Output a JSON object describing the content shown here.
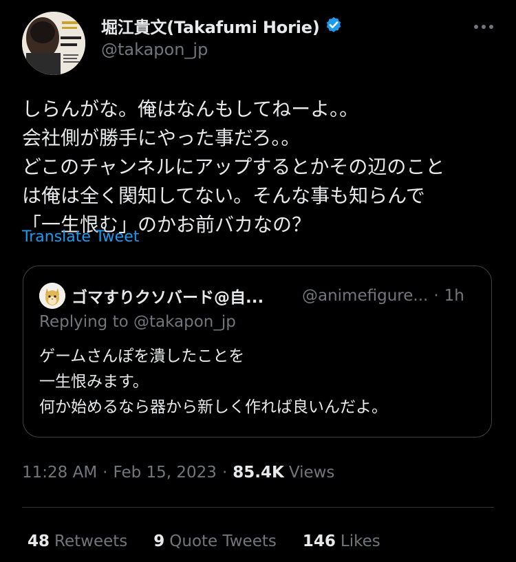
{
  "author": {
    "display_name": "堀江貴文(Takafumi Horie)",
    "handle": "@takapon_jp",
    "verified_icon": "verified-badge-icon",
    "avatar_icon": "profile-photo",
    "verified_color": "#1d9bf0"
  },
  "more_icon": "more-dots-icon",
  "tweet": {
    "lines": [
      "しらんがな。俺はなんもしてねーよ。。",
      "会社側が勝手にやった事だろ。。",
      "どこのチャンネルにアップするとかその辺のこと",
      "は俺は全く関知してない。そんな事も知らんで",
      "「一生恨む」のかお前バカなの？"
    ],
    "translate_label": "Translate Tweet"
  },
  "quoted_tweet": {
    "display_name": "ゴマすりクソバード@自...",
    "handle": "@animefigure...",
    "time_separator": "·",
    "time": "1h",
    "replying_to": "Replying to @takapon_jp",
    "lines": [
      "ゲームさんぽを潰したことを",
      "一生恨みます。",
      "何か始めるなら器から新しく作れば良いんだよ。"
    ]
  },
  "meta": {
    "time": "11:28 AM",
    "separator": "·",
    "date": "Feb 15, 2023",
    "views_count": "85.4K",
    "views_label": "Views"
  },
  "stats": {
    "retweets_count": "48",
    "retweets_label": "Retweets",
    "quotes_count": "9",
    "quotes_label": "Quote Tweets",
    "likes_count": "146",
    "likes_label": "Likes"
  },
  "colors": {
    "background": "#000000",
    "primary_text": "#e7e9ea",
    "secondary_text": "#71767b",
    "link": "#1d9bf0",
    "border": "#2f3336"
  }
}
